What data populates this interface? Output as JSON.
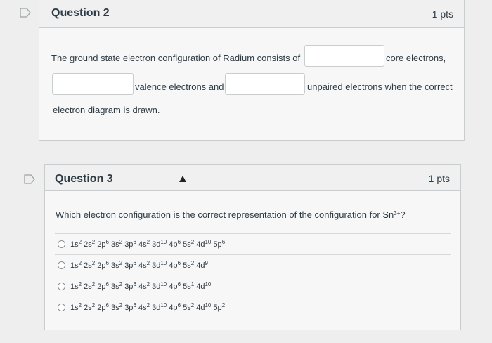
{
  "q2": {
    "title": "Question 2",
    "points": "1 pts",
    "text_part1": "The ground state electron configuration of Radium consists of",
    "text_part2": "core electrons,",
    "text_part3": "valence electrons and",
    "text_part4": "unpaired electrons when the correct",
    "text_part5": "electron diagram is drawn."
  },
  "q3": {
    "title": "Question 3",
    "points": "1 pts",
    "prompt": "Which electron configuration is the correct representation of the configuration for Sn",
    "prompt_superscript": "3+",
    "prompt_end": "?",
    "options": [
      {
        "orbitals": [
          [
            "1s",
            "2"
          ],
          [
            "2s",
            "2"
          ],
          [
            "2p",
            "6"
          ],
          [
            "3s",
            "2"
          ],
          [
            "3p",
            "6"
          ],
          [
            "4s",
            "2"
          ],
          [
            "3d",
            "10"
          ],
          [
            "4p",
            "6"
          ],
          [
            "5s",
            "2"
          ],
          [
            "4d",
            "10"
          ],
          [
            "5p",
            "6"
          ]
        ]
      },
      {
        "orbitals": [
          [
            "1s",
            "2"
          ],
          [
            "2s",
            "2"
          ],
          [
            "2p",
            "6"
          ],
          [
            "3s",
            "2"
          ],
          [
            "3p",
            "6"
          ],
          [
            "4s",
            "2"
          ],
          [
            "3d",
            "10"
          ],
          [
            "4p",
            "6"
          ],
          [
            "5s",
            "2"
          ],
          [
            "4d",
            "9"
          ]
        ]
      },
      {
        "orbitals": [
          [
            "1s",
            "2"
          ],
          [
            "2s",
            "2"
          ],
          [
            "2p",
            "6"
          ],
          [
            "3s",
            "2"
          ],
          [
            "3p",
            "6"
          ],
          [
            "4s",
            "2"
          ],
          [
            "3d",
            "10"
          ],
          [
            "4p",
            "6"
          ],
          [
            "5s",
            "1"
          ],
          [
            "4d",
            "10"
          ]
        ]
      },
      {
        "orbitals": [
          [
            "1s",
            "2"
          ],
          [
            "2s",
            "2"
          ],
          [
            "2p",
            "6"
          ],
          [
            "3s",
            "2"
          ],
          [
            "3p",
            "6"
          ],
          [
            "4s",
            "2"
          ],
          [
            "3d",
            "10"
          ],
          [
            "4p",
            "6"
          ],
          [
            "5s",
            "2"
          ],
          [
            "4d",
            "10"
          ],
          [
            "5p",
            "2"
          ]
        ]
      }
    ]
  }
}
